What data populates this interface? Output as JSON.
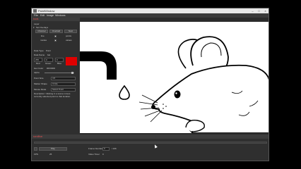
{
  "window": {
    "title": "PaintWindow"
  },
  "menu": [
    "File",
    "Edit",
    "Image",
    "Windows"
  ],
  "left_panel": {
    "header": "tools",
    "section_label": "Layer",
    "subsection_label": "Set Overlays",
    "tabs": [
      "Channel",
      "Overlaid",
      "Next"
    ],
    "rows": [
      {
        "label": "line",
        "value": "points"
      },
      {
        "label": "modes",
        "value": "values"
      }
    ],
    "data_type": {
      "label": "Data Type",
      "value": "Point"
    },
    "data_name": {
      "label": "Data Name",
      "value": "bat"
    },
    "rgb": {
      "values": [
        "255",
        "0",
        "0"
      ],
      "labels": [
        "Red",
        "Green",
        "Blue"
      ]
    },
    "color_hex": {
      "label": "Hex Color",
      "value": "#FF0000"
    },
    "alpha_label": "Alpha",
    "point_size": {
      "label": "Point Size",
      "value": "4.5"
    },
    "marker_shape": {
      "label": "Marker Shape",
      "value": "Circle"
    },
    "mouse_mode": {
      "label": "Mouse Mode",
      "value": "Select Point"
    },
    "description": "Description: Clicking in a scene moves currently selected point to that location."
  },
  "colors": {
    "accent_red": "#e00000",
    "panel_bg": "#2f2f2f",
    "canvas_bg": "#ffffff"
  },
  "bottom_dock": {
    "header": "scrollbar",
    "play_label": "Play",
    "frame_number_label": "Frame Number",
    "frame_value": "0",
    "frame_total": "/ 166",
    "fps_label": "FPS",
    "fps_value": "25",
    "video_timer_label": "Video Timer",
    "video_timer_value": "0"
  }
}
